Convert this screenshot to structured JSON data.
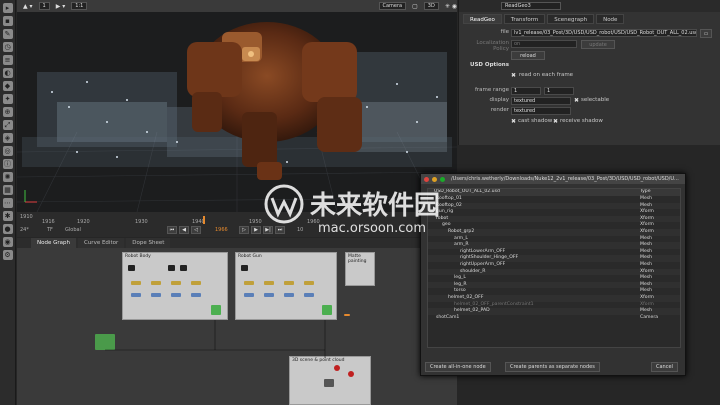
{
  "viewer": {
    "frame": "1",
    "zoom": "1:1",
    "camera": "Camera",
    "mode": "3D",
    "timeline": {
      "ticks": [
        "1910",
        "1916",
        "1920",
        "1930",
        "1940",
        "1950",
        "1960"
      ],
      "fps": "24*",
      "tf": "TF",
      "global": "Global",
      "current_frame": "1966",
      "step": "10"
    }
  },
  "properties": {
    "node_name": "ReadGeo3",
    "tabs": [
      "ReadGeo",
      "Transform",
      "Scenegraph",
      "Node"
    ],
    "file_label": "file",
    "file_value": "lv1_release/03_Post/3D/USD/USD_robot/USD/USD_Robot_OUT_ALL_02.usd",
    "localization_label": "Localization Policy",
    "localization_value": "on",
    "update_button": "update",
    "reload_button": "reload",
    "usd_options_label": "USD Options",
    "read_each_frame": "read on each frame",
    "frame_range_label": "frame range",
    "frame_start": "1",
    "frame_end": "1",
    "display_label": "display",
    "display_value": "textured",
    "selectable": "selectable",
    "render_label": "render",
    "render_value": "textured",
    "cast_shadow": "cast shadow",
    "receive_shadow": "receive shadow"
  },
  "graph": {
    "tabs": [
      "Node Graph",
      "Curve Editor",
      "Dope Sheet"
    ],
    "backdrop1": "Robot Body",
    "backdrop2": "Robot Gun",
    "backdrop3": "Matte painting",
    "backdrop4": "3D scene & point cloud"
  },
  "dialog": {
    "path": "/Users/chris.wetherly/Downloads/Nuke12_2v1_release/03_Post/3D/USD/USD_robot/USD/U...",
    "header_name": "USD_Robot_OUT_ALL_02.usd",
    "header_type": "Type",
    "rows": [
      {
        "name": "Rooftop_01",
        "type": "Mesh",
        "indent": 0
      },
      {
        "name": "Rooftop_02",
        "type": "Mesh",
        "indent": 0
      },
      {
        "name": "gun_rig",
        "type": "Xform",
        "indent": 0
      },
      {
        "name": "robot",
        "type": "Xform",
        "indent": 0
      },
      {
        "name": "geo",
        "type": "Xform",
        "indent": 1
      },
      {
        "name": "Robot_grp2",
        "type": "Xform",
        "indent": 2
      },
      {
        "name": "arm_L",
        "type": "Mesh",
        "indent": 3
      },
      {
        "name": "arm_R",
        "type": "Mesh",
        "indent": 3
      },
      {
        "name": "rightLowerArm_OFF",
        "type": "Mesh",
        "indent": 4
      },
      {
        "name": "rightShoulder_Hinge_OFF",
        "type": "Mesh",
        "indent": 4
      },
      {
        "name": "rightUpperArm_OFF",
        "type": "Mesh",
        "indent": 4
      },
      {
        "name": "shoulder_R",
        "type": "Xform",
        "indent": 4
      },
      {
        "name": "leg_L",
        "type": "Mesh",
        "indent": 3
      },
      {
        "name": "leg_R",
        "type": "Mesh",
        "indent": 3
      },
      {
        "name": "torso",
        "type": "Mesh",
        "indent": 3
      },
      {
        "name": "helmet_02_OFF",
        "type": "Xform",
        "indent": 2
      },
      {
        "name": "helmet_02_OFF_parentConstraint1",
        "type": "Xform",
        "indent": 3,
        "dim": true
      },
      {
        "name": "helmet_02_PAD",
        "type": "Mesh",
        "indent": 3
      },
      {
        "name": "shotCam1",
        "type": "Camera",
        "indent": 0
      }
    ],
    "btn_all_in_one": "Create all-in-one node",
    "btn_separate": "Create parents as separate nodes",
    "btn_cancel": "Cancel"
  },
  "watermark": {
    "cn": "未来软件园",
    "url": "mac.orsoon.com"
  }
}
